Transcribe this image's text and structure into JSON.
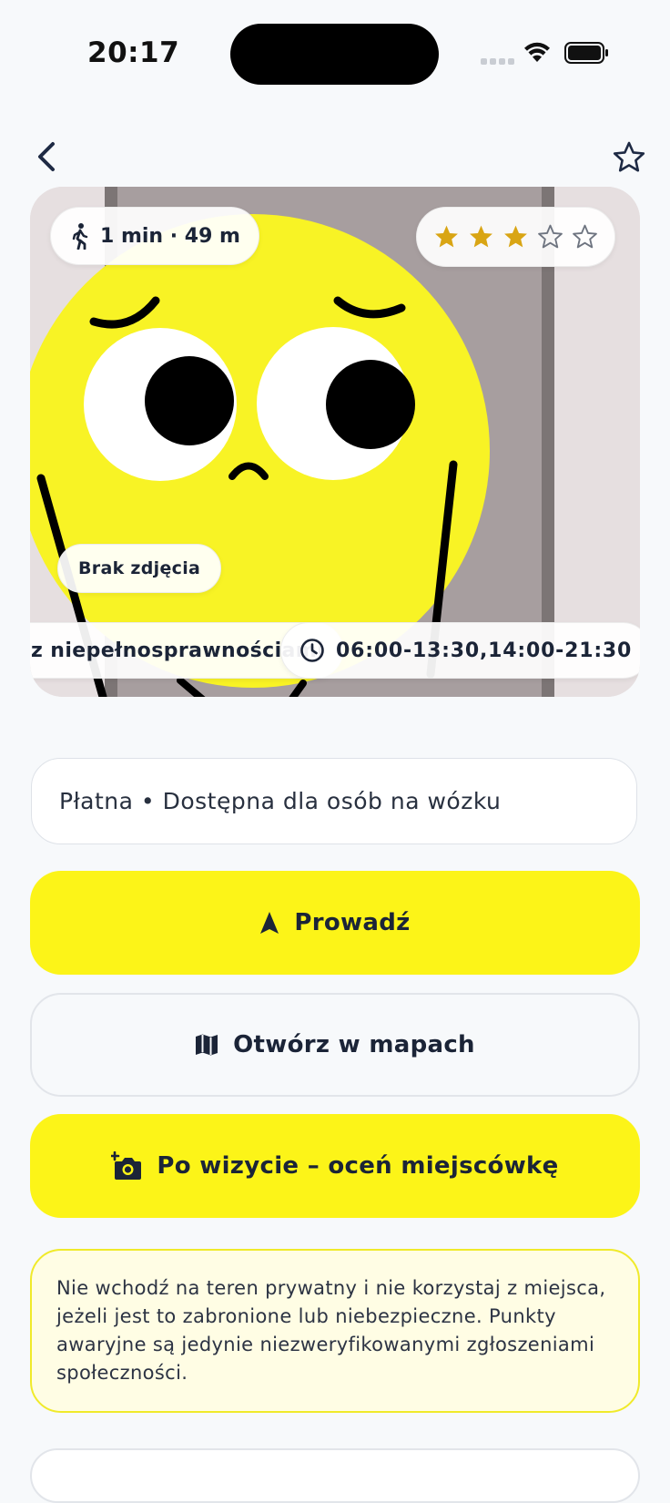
{
  "status_bar": {
    "time": "20:17"
  },
  "hero": {
    "walk_info": "1 min · 49 m",
    "rating": {
      "value": 3,
      "max": 5
    },
    "photo_badge": "Brak zdjęcia",
    "accessibility_tag": "z niepełnosprawnościami",
    "hours": "06:00-13:30,14:00-21:30"
  },
  "info_line": "Płatna • Dostępna dla osób na wózku",
  "buttons": {
    "navigate": "Prowadź",
    "open_maps": "Otwórz w mapach",
    "rate": "Po wizycie – oceń miejscówkę"
  },
  "warning_text": "Nie wchodź na teren prywatny i nie korzystaj z miejsca, jeżeli jest to zabronione lub niebezpieczne. Punkty awaryjne są jedynie niezweryfikowanymi zgłoszeniami społeczności.",
  "colors": {
    "accent_yellow": "#FCF418",
    "star_filled": "#D9A514",
    "text_dark": "#1B2437"
  },
  "icons": [
    "back-chevron-icon",
    "star-outline-icon",
    "walking-icon",
    "clock-icon",
    "navigation-arrow-icon",
    "map-icon",
    "camera-plus-icon"
  ]
}
